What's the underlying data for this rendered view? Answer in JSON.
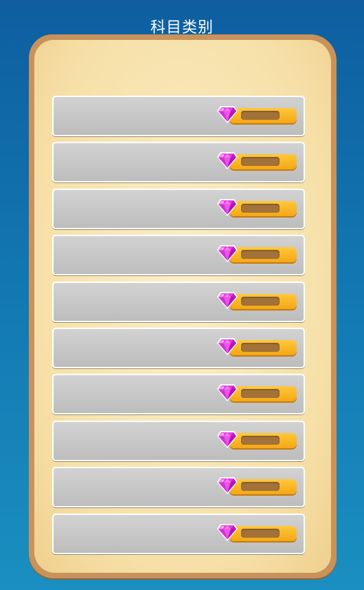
{
  "header": {
    "title": "科目类别"
  },
  "categories": [
    {
      "label": "",
      "gem_value": ""
    },
    {
      "label": "",
      "gem_value": ""
    },
    {
      "label": "",
      "gem_value": ""
    },
    {
      "label": "",
      "gem_value": ""
    },
    {
      "label": "",
      "gem_value": ""
    },
    {
      "label": "",
      "gem_value": ""
    },
    {
      "label": "",
      "gem_value": ""
    },
    {
      "label": "",
      "gem_value": ""
    },
    {
      "label": "",
      "gem_value": ""
    },
    {
      "label": "",
      "gem_value": ""
    }
  ],
  "icons": {
    "row_icon": "gem-icon"
  },
  "colors": {
    "background": "#1276b0",
    "panel": "#f6e0a8",
    "panel_border": "#c9925b",
    "row": "#c8c8c8",
    "gem": "#e040e0",
    "bar": "#f8b526",
    "bar_slot": "#a27238"
  }
}
